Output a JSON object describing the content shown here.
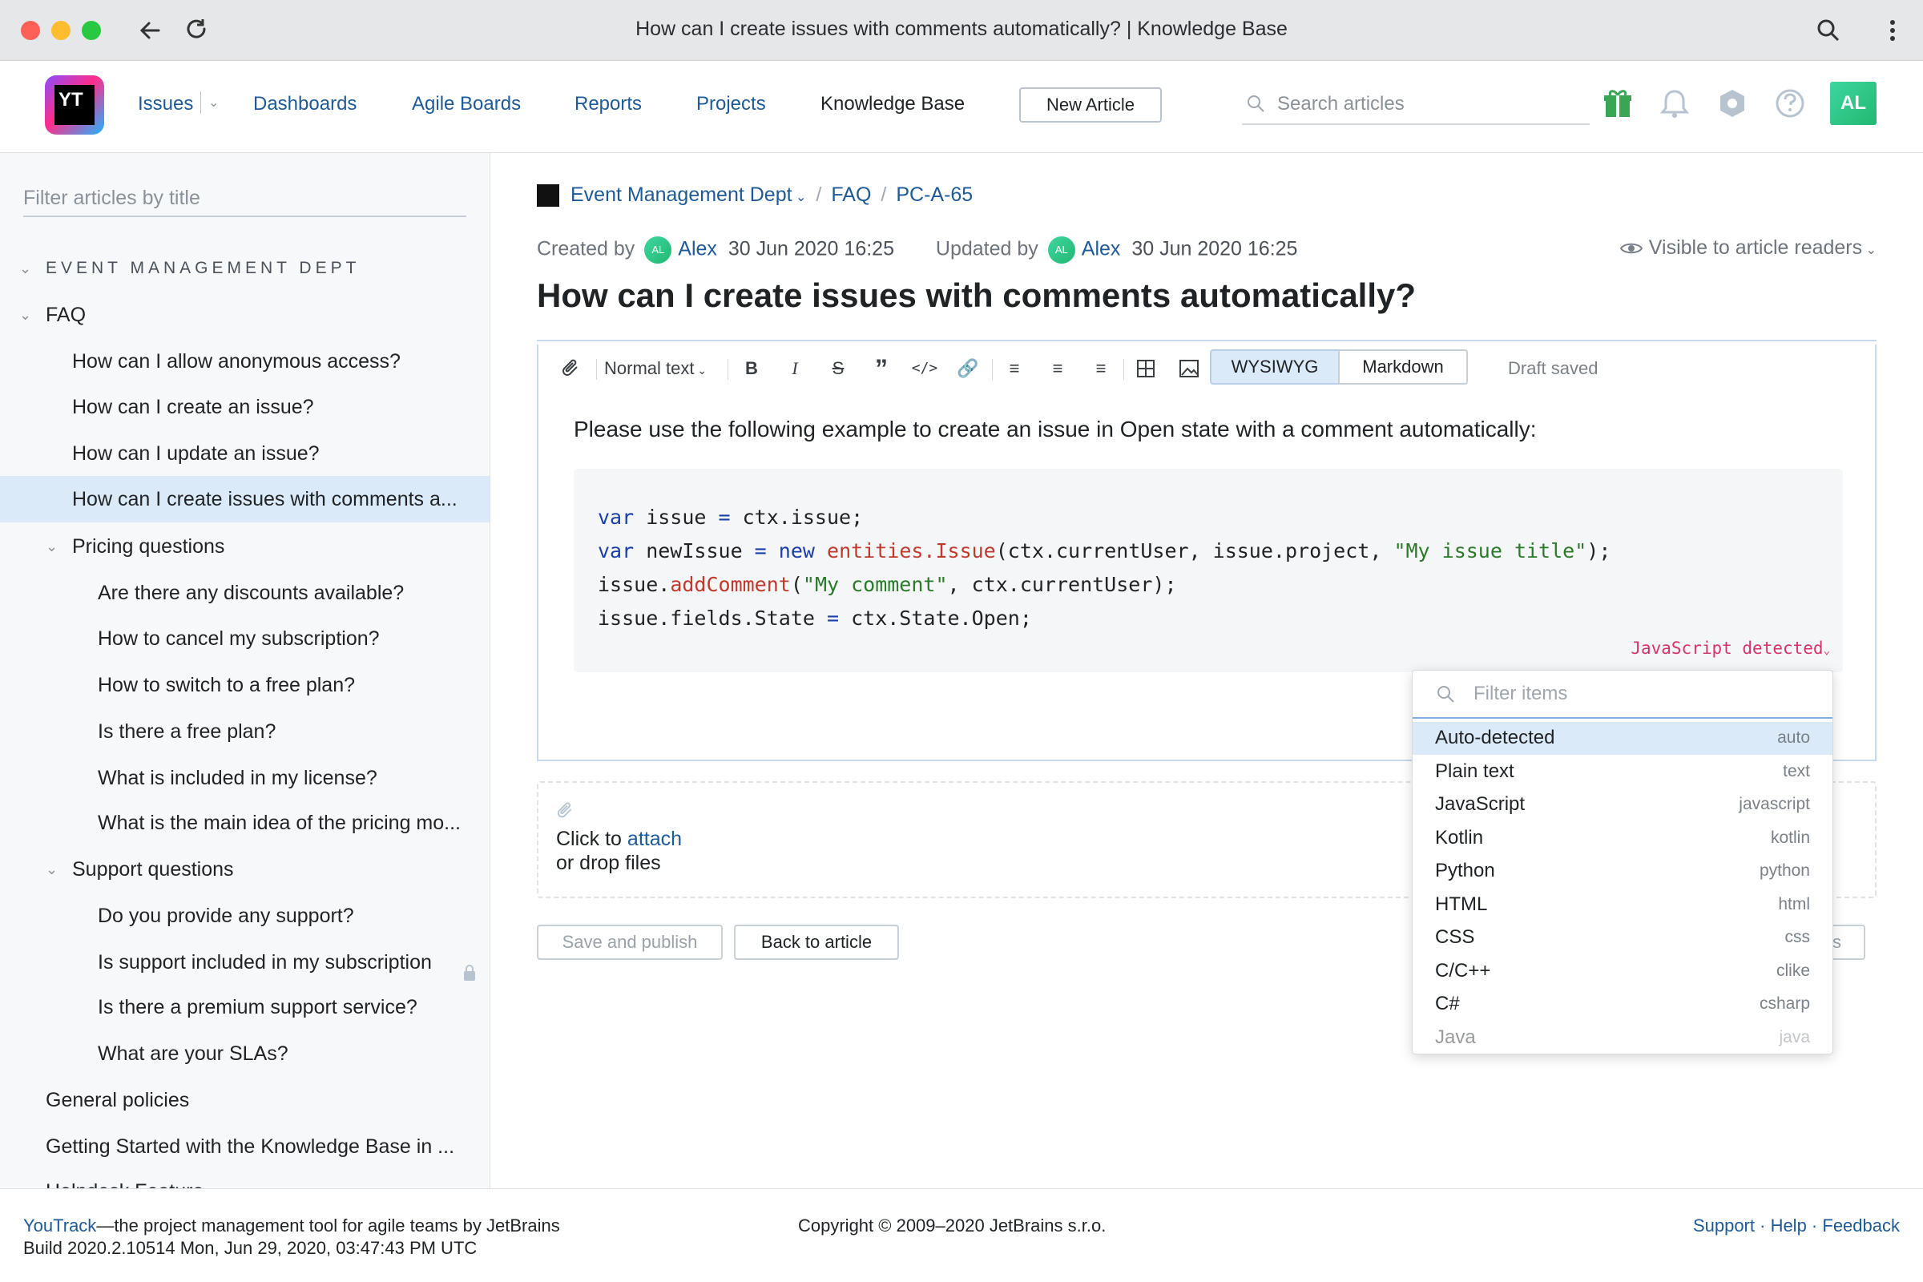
{
  "browser": {
    "title": "How can I create issues with comments automatically? | Knowledge Base"
  },
  "header": {
    "logo_text": "YT",
    "nav": {
      "issues": "Issues",
      "dashboards": "Dashboards",
      "agile_boards": "Agile Boards",
      "reports": "Reports",
      "projects": "Projects",
      "knowledge_base": "Knowledge Base"
    },
    "new_article": "New Article",
    "search_placeholder": "Search articles",
    "avatar": "AL"
  },
  "sidebar": {
    "filter_placeholder": "Filter articles by title",
    "section": "EVENT MANAGEMENT DEPT",
    "items": [
      "FAQ",
      "How can I allow anonymous access?",
      "How can I create an issue?",
      "How can I update an issue?",
      "How can I create issues with comments a...",
      "Pricing questions",
      "Are there any discounts available?",
      "How to cancel my subscription?",
      "How to switch to a free plan?",
      "Is there a free plan?",
      "What is included in my license?",
      "What is the main idea of the pricing mo...",
      "Support questions",
      "Do you provide any support?",
      "Is support included in my subscription",
      "Is there a premium support service?",
      "What are your SLAs?",
      "General policies",
      "Getting Started with the Knowledge Base in ...",
      "Helpdesk Feature"
    ]
  },
  "article": {
    "breadcrumb": {
      "project": "Event Management Dept",
      "folder": "FAQ",
      "id": "PC-A-65"
    },
    "created_label": "Created by",
    "created_avatar": "AL",
    "created_by": "Alex",
    "created_at": "30 Jun 2020 16:25",
    "updated_label": "Updated by",
    "updated_avatar": "AL",
    "updated_by": "Alex",
    "updated_at": "30 Jun 2020 16:25",
    "visibility": "Visible to article readers",
    "title": "How can I create issues with comments automatically?"
  },
  "editor": {
    "text_style": "Normal text",
    "mode_wysiwyg": "WYSIWYG",
    "mode_markdown": "Markdown",
    "status": "Draft saved",
    "intro": "Please use the following example to create an issue in Open state with a comment automatically:",
    "language_detected": "JavaScript detected"
  },
  "attachments": {
    "click_to": "Click to",
    "attach": "attach",
    "or_drop": "or drop files"
  },
  "actions": {
    "save": "Save and publish",
    "back": "Back to article",
    "hidden_button_tail": "s"
  },
  "dropdown": {
    "filter_placeholder": "Filter items",
    "items": [
      {
        "label": "Auto-detected",
        "value": "auto"
      },
      {
        "label": "Plain text",
        "value": "text"
      },
      {
        "label": "JavaScript",
        "value": "javascript"
      },
      {
        "label": "Kotlin",
        "value": "kotlin"
      },
      {
        "label": "Python",
        "value": "python"
      },
      {
        "label": "HTML",
        "value": "html"
      },
      {
        "label": "CSS",
        "value": "css"
      },
      {
        "label": "C/C++",
        "value": "clike"
      },
      {
        "label": "C#",
        "value": "csharp"
      },
      {
        "label": "Java",
        "value": "java"
      }
    ]
  },
  "footer": {
    "brand": "YouTrack",
    "tagline": "—the project management tool for agile teams by JetBrains",
    "build": "Build 2020.2.10514 Mon, Jun 29, 2020, 03:47:43 PM UTC",
    "copyright": "Copyright © 2009–2020 JetBrains s.r.o.",
    "support": "Support",
    "help": "Help",
    "feedback": "Feedback"
  },
  "colors": {
    "link": "#1e5a97",
    "selected_bg": "#dbeaf8",
    "accent_pink": "#d6336c",
    "avatar_green": "#21b871"
  }
}
